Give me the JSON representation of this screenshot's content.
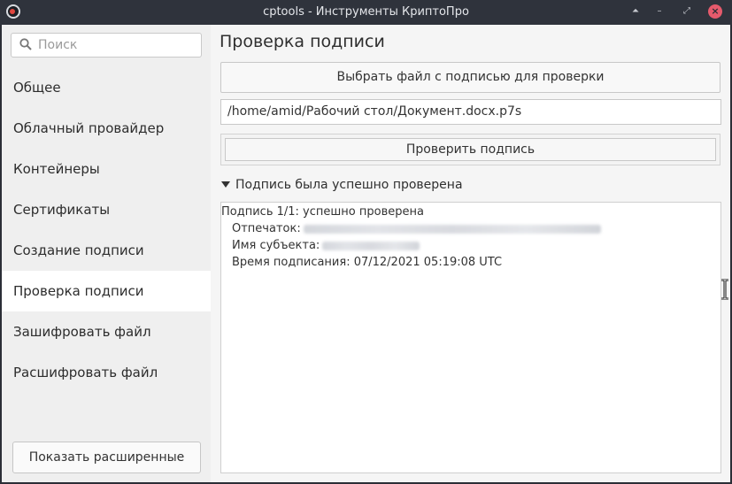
{
  "window": {
    "title": "cptools - Инструменты КриптоПро",
    "controls": {
      "shade": "⏶",
      "minimize": "–",
      "maximize": "⤢",
      "close": "×"
    }
  },
  "sidebar": {
    "search_placeholder": "Поиск",
    "items": [
      {
        "label": "Общее",
        "active": false
      },
      {
        "label": "Облачный провайдер",
        "active": false
      },
      {
        "label": "Контейнеры",
        "active": false
      },
      {
        "label": "Сертификаты",
        "active": false
      },
      {
        "label": "Создание подписи",
        "active": false
      },
      {
        "label": "Проверка подписи",
        "active": true
      },
      {
        "label": "Зашифровать файл",
        "active": false
      },
      {
        "label": "Расшифровать файл",
        "active": false
      }
    ],
    "advanced_button": "Показать расширенные"
  },
  "main": {
    "title": "Проверка подписи",
    "select_file_button": "Выбрать файл с подписью для проверки",
    "file_path": "/home/amid/Рабочий стол/Документ.docx.p7s",
    "verify_button": "Проверить подпись",
    "result_header": "Подпись была успешно проверена",
    "result": {
      "summary": "Подпись 1/1: успешно проверена",
      "thumbprint_label": "Отпечаток:",
      "subject_label": "Имя субъекта:",
      "signing_time": "Время подписания: 07/12/2021 05:19:08 UTC"
    }
  },
  "colors": {
    "titlebar": "#2f333c",
    "close_button": "#e55a6c",
    "sidebar_bg": "#efefef",
    "active_item_bg": "#ffffff"
  }
}
